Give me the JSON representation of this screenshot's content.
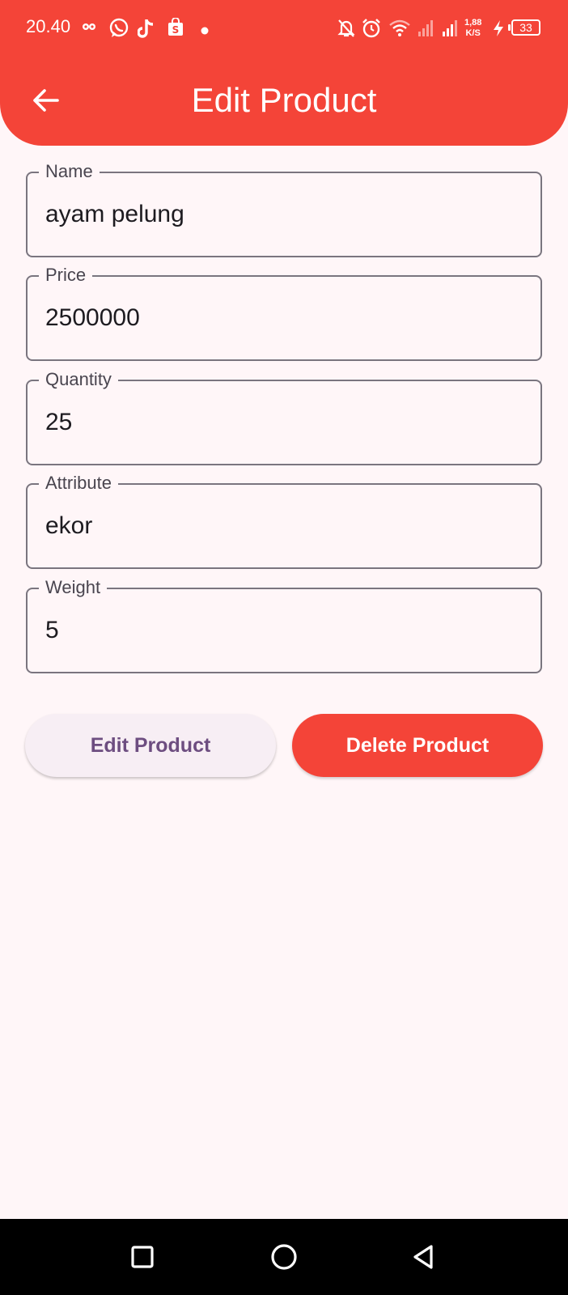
{
  "status_bar": {
    "time": "20.40",
    "net_speed_value": "1,88",
    "net_speed_unit": "K/S",
    "battery": "33",
    "icons": [
      "infinity-icon",
      "whatsapp-icon",
      "tiktok-icon",
      "shopping-bag-icon",
      "dot-icon",
      "bell-off-icon",
      "alarm-icon",
      "wifi-icon",
      "signal-icon",
      "signal-icon",
      "charging-icon",
      "battery-icon"
    ]
  },
  "app_bar": {
    "title": "Edit Product",
    "back_icon": "arrow-left-icon",
    "color": "#f44438"
  },
  "form": {
    "fields": [
      {
        "label": "Name",
        "value": "ayam pelung"
      },
      {
        "label": "Price",
        "value": "2500000"
      },
      {
        "label": "Quantity",
        "value": "25"
      },
      {
        "label": "Attribute",
        "value": "ekor"
      },
      {
        "label": "Weight",
        "value": "5"
      }
    ]
  },
  "actions": {
    "edit_label": "Edit Product",
    "delete_label": "Delete Product"
  },
  "nav_bar": {
    "icons": [
      "square-icon",
      "circle-icon",
      "triangle-back-icon"
    ]
  },
  "colors": {
    "primary": "#f44438",
    "background": "#fff6f8",
    "edit_text": "#6d4d80"
  }
}
